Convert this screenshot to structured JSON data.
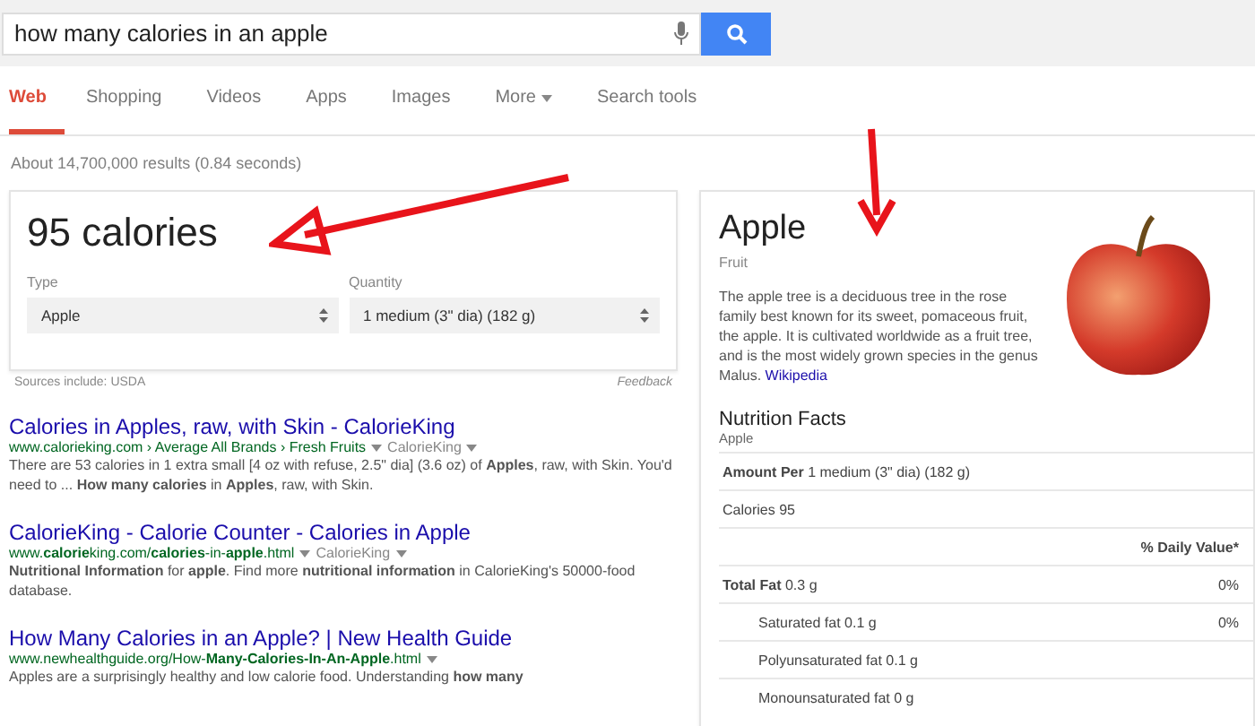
{
  "search": {
    "value": "how many calories in an apple"
  },
  "tabs": [
    {
      "label": "Web",
      "selected": true,
      "dropdown": false
    },
    {
      "label": "Shopping",
      "selected": false,
      "dropdown": false
    },
    {
      "label": "Videos",
      "selected": false,
      "dropdown": false
    },
    {
      "label": "Apps",
      "selected": false,
      "dropdown": false
    },
    {
      "label": "Images",
      "selected": false,
      "dropdown": false
    },
    {
      "label": "More",
      "selected": false,
      "dropdown": true
    },
    {
      "label": "Search tools",
      "selected": false,
      "dropdown": false
    }
  ],
  "result_stats": "About 14,700,000 results (0.84 seconds)",
  "answer_card": {
    "value": "95 calories",
    "selects": [
      {
        "label": "Type",
        "value": "Apple"
      },
      {
        "label": "Quantity",
        "value": "1 medium (3\" dia) (182 g)"
      }
    ],
    "sources": "Sources include: USDA",
    "feedback": "Feedback"
  },
  "results": [
    {
      "title": "Calories in Apples, raw, with Skin - CalorieKing",
      "url": "www.calorieking.com › Average All Brands › Fresh Fruits",
      "source": "CalorieKing",
      "snippet": "There are 53 calories in 1 extra small [4 oz with refuse, 2.5\" dia] (3.6 oz) of **Apples**, raw, with Skin. You'd need to ... **How many calories** in **Apples**, raw, with Skin."
    },
    {
      "title": "CalorieKing - Calorie Counter - Calories in Apple",
      "url": "www.**calorie**king.com/**calories**-in-**apple**.html",
      "source": "CalorieKing",
      "snippet": "**Nutritional Information** for **apple**. Find more **nutritional information** in CalorieKing's 50000-food database."
    },
    {
      "title": "How Many Calories in an Apple? | New Health Guide",
      "url": "www.newhealthguide.org/How-**Many-Calories-In-An-Apple**.html",
      "snippet": "Apples are a surprisingly healthy and low calorie food. Understanding **how many**"
    }
  ],
  "knowledge_panel": {
    "title": "Apple",
    "subtitle": "Fruit",
    "description": "The apple tree is a deciduous tree in the rose family best known for its sweet, pomaceous fruit, the apple. It is cultivated worldwide as a fruit tree, and is the most widely grown species in the genus Malus.",
    "link": "Wikipedia",
    "nutrition": {
      "title": "Nutrition Facts",
      "subtitle": "Apple",
      "rows": [
        {
          "kind": "main",
          "label": "**Amount Per** 1 medium (3\" dia) (182 g)"
        },
        {
          "kind": "main",
          "label": "Calories 95"
        },
        {
          "kind": "head",
          "value": "% Daily Value*"
        },
        {
          "kind": "main",
          "label": "**Total Fat** 0.3 g",
          "value": "0%"
        },
        {
          "kind": "sub",
          "label": "Saturated fat 0.1 g",
          "value": "0%"
        },
        {
          "kind": "sub",
          "label": "Polyunsaturated fat 0.1 g"
        },
        {
          "kind": "sub",
          "label": "Monounsaturated fat 0 g"
        }
      ]
    }
  }
}
